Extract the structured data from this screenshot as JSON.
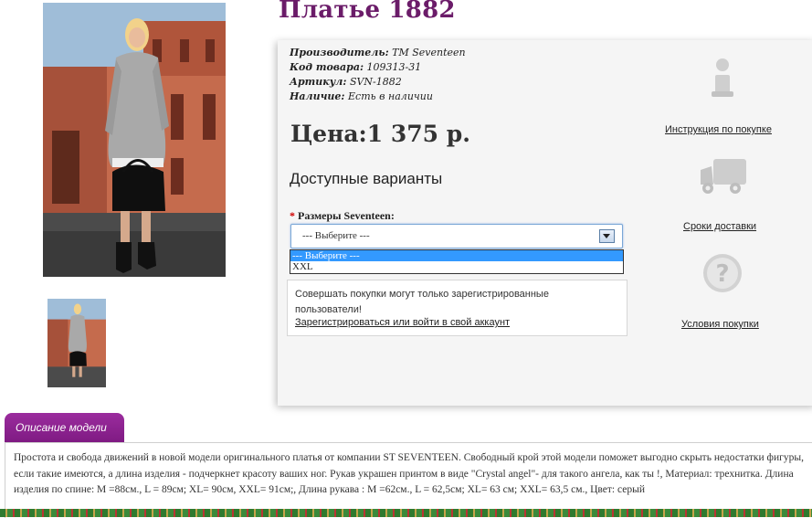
{
  "product": {
    "title": "Платье 1882",
    "meta": [
      {
        "label": "Производитель:",
        "value": "TM Seventeen"
      },
      {
        "label": "Код товара:",
        "value": "109313-31"
      },
      {
        "label": "Артикул:",
        "value": "SVN-1882"
      },
      {
        "label": "Наличие:",
        "value": "Есть в наличии"
      }
    ],
    "price": "Цена:1 375 р."
  },
  "options": {
    "heading": "Доступные варианты",
    "size_label": "Размеры Seventeen:",
    "required_mark": "*",
    "select": {
      "value": "--- Выберите ---",
      "options": [
        "--- Выберите ---",
        "XXL"
      ]
    }
  },
  "notice": {
    "text": "Совершать покупки могут только зарегистрированные пользователи!",
    "link": "Зарегистрироваться или войти в свой аккаунт"
  },
  "sidebar_links": [
    {
      "label": "Инструкция по покупке",
      "icon": "info-icon"
    },
    {
      "label": "Сроки доставки",
      "icon": "truck-icon"
    },
    {
      "label": "Условия покупки",
      "icon": "question-icon"
    }
  ],
  "description": {
    "tab_label": "Описание модели",
    "text": "Простота и свобода движений в новой модели оригинального платья от компании ST SEVENTEEN. Свободный крой этой модели поможет выгодно скрыть недостатки фигуры, если такие имеются, а длина изделия - подчеркнет красоту ваших ног. Рукав украшен принтом в виде \"Crystal angel\"- для такого ангела, как ты !, Материал: трехнитка. Длина изделия по спине: M =88см., L = 89см; XL= 90см, XXL= 91см;, Длина рукава : M =62см., L = 62,5см; XL= 63 см; XXL= 63,5 см., Цвет: серый"
  },
  "colors": {
    "title": "#6b1c69",
    "tab": "#8e2391",
    "select_highlight": "#3399ff",
    "required": "#d00000"
  }
}
